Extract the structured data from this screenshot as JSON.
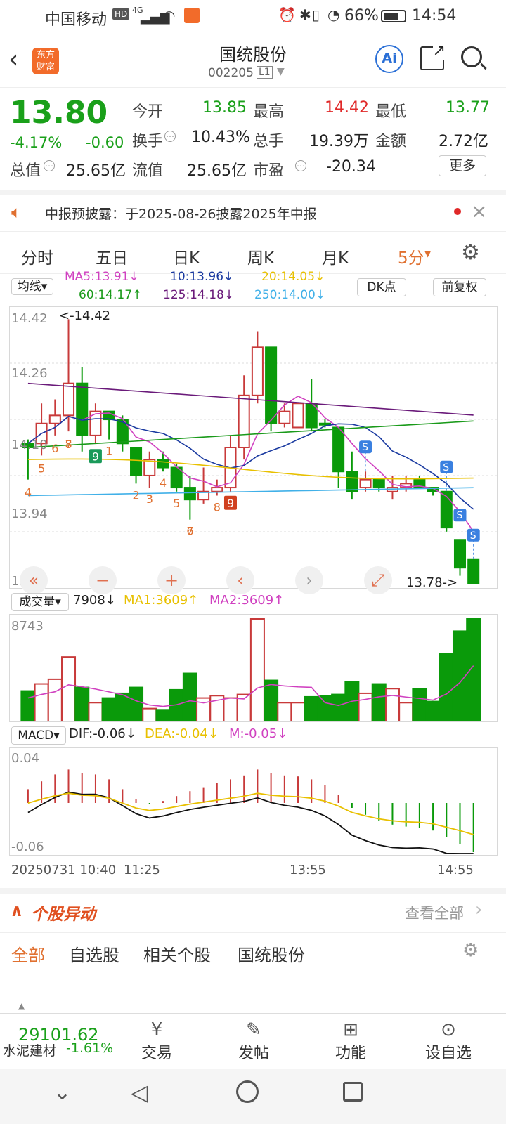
{
  "status": {
    "carrier": "中国移动",
    "hd": "HD",
    "net": "4G",
    "battery": "66%",
    "time": "14:54"
  },
  "header": {
    "title": "国统股份",
    "code": "002205",
    "level": "L1",
    "ai": "Ai"
  },
  "quote": {
    "price": "13.80",
    "pct": "-4.17%",
    "chg": "-0.60",
    "open_label": "今开",
    "open": "13.85",
    "high_label": "最高",
    "high": "14.42",
    "low_label": "最低",
    "low": "13.77",
    "turn_label": "换手",
    "turn": "10.43%",
    "vol_label": "总手",
    "vol": "19.39万",
    "amt_label": "金额",
    "amt": "2.72亿",
    "mcap_label": "总值",
    "mcap": "25.65亿",
    "fcap_label": "流值",
    "fcap": "25.65亿",
    "pe_label": "市盈",
    "pe": "-20.34",
    "more": "更多"
  },
  "notice": {
    "text": "中报预披露：于2025-08-26披露2025年中报"
  },
  "tabs": [
    "分时",
    "五日",
    "日K",
    "周K",
    "月K",
    "5分"
  ],
  "ma_bar": {
    "select": "均线",
    "dk": "DK点",
    "adj": "前复权",
    "ma5": "MA5:13.91↓",
    "ma10": "10:13.96↓",
    "ma20": "20:14.05↓",
    "ma60": "60:14.17↑",
    "ma125": "125:14.18↓",
    "ma250": "250:14.00↓"
  },
  "kline": {
    "ymax": "14.42",
    "y2": "14.26",
    "y3": "14.10",
    "y4": "13.94",
    "ymin": "13.78",
    "hi_note": "<-14.42",
    "lo_note": "13.78->",
    "signals": [
      "S",
      "S",
      "S",
      "S"
    ],
    "counts": [
      {
        "t": "4"
      },
      {
        "t": "5"
      },
      {
        "t": "6"
      },
      {
        "t": "7"
      },
      {
        "t": "8"
      },
      {
        "t": "9"
      },
      {
        "t": "1"
      },
      {
        "t": "2"
      },
      {
        "t": "3"
      },
      {
        "t": "4"
      },
      {
        "t": "5"
      },
      {
        "t": "6"
      },
      {
        "t": "7"
      },
      {
        "t": "8"
      },
      {
        "t": "9"
      }
    ]
  },
  "volume": {
    "select": "成交量",
    "value": "7908↓",
    "ma1": "MA1:3609↑",
    "ma2": "MA2:3609↑",
    "ymax": "8743"
  },
  "macd": {
    "select": "MACD",
    "dif": "DIF:-0.06↓",
    "dea": "DEA:-0.04↓",
    "m": "M:-0.05↓",
    "ymax": "0.04",
    "ymin": "-0.06"
  },
  "xaxis": {
    "start": "20250731 10:40",
    "t1": "11:25",
    "t2": "13:55",
    "t3": "14:55"
  },
  "chart_data": {
    "type": "candlestick",
    "candles": [
      [
        14.1,
        14.12,
        14.02,
        14.11,
        "d"
      ],
      [
        14.11,
        14.21,
        14.08,
        14.16,
        "u"
      ],
      [
        14.16,
        14.22,
        14.13,
        14.18,
        "u"
      ],
      [
        14.18,
        14.42,
        14.14,
        14.26,
        "u"
      ],
      [
        14.26,
        14.3,
        14.09,
        14.13,
        "d"
      ],
      [
        14.13,
        14.21,
        14.11,
        14.19,
        "u"
      ],
      [
        14.19,
        14.19,
        14.12,
        14.17,
        "d"
      ],
      [
        14.17,
        14.18,
        14.09,
        14.11,
        "d"
      ],
      [
        14.1,
        14.1,
        14.01,
        14.03,
        "d"
      ],
      [
        14.03,
        14.09,
        14.0,
        14.07,
        "u"
      ],
      [
        14.07,
        14.09,
        14.04,
        14.05,
        "d"
      ],
      [
        14.05,
        14.06,
        13.99,
        14.0,
        "d"
      ],
      [
        14.0,
        14.03,
        13.92,
        13.97,
        "d"
      ],
      [
        13.97,
        14.05,
        13.96,
        13.99,
        "u"
      ],
      [
        13.99,
        14.02,
        13.98,
        14.0,
        "u"
      ],
      [
        14.0,
        14.13,
        13.99,
        14.1,
        "u"
      ],
      [
        14.1,
        14.28,
        14.07,
        14.23,
        "u"
      ],
      [
        14.23,
        14.39,
        14.21,
        14.35,
        "u"
      ],
      [
        14.35,
        14.35,
        14.14,
        14.16,
        "d"
      ],
      [
        14.16,
        14.21,
        14.15,
        14.19,
        "u"
      ],
      [
        14.15,
        14.21,
        14.15,
        14.21,
        "u"
      ],
      [
        14.21,
        14.27,
        14.14,
        14.15,
        "d"
      ],
      [
        14.16,
        14.17,
        14.15,
        14.16,
        "d"
      ],
      [
        14.15,
        14.15,
        14.0,
        14.04,
        "d"
      ],
      [
        14.04,
        14.09,
        13.97,
        13.99,
        "d"
      ],
      [
        14.0,
        14.04,
        13.99,
        14.02,
        "u"
      ],
      [
        14.02,
        14.02,
        13.99,
        14.0,
        "d"
      ],
      [
        14.0,
        14.03,
        13.97,
        13.99,
        "u"
      ],
      [
        14.0,
        14.03,
        13.99,
        14.01,
        "u"
      ],
      [
        14.02,
        14.03,
        14.0,
        14.0,
        "d"
      ],
      [
        14.0,
        14.0,
        13.98,
        13.99,
        "d"
      ],
      [
        13.99,
        13.99,
        13.89,
        13.9,
        "d"
      ],
      [
        13.87,
        13.87,
        13.78,
        13.8,
        "d"
      ],
      [
        13.82,
        13.82,
        13.76,
        13.76,
        "d"
      ]
    ],
    "volume": [
      2600,
      3200,
      3600,
      5500,
      2900,
      1600,
      2000,
      2400,
      2900,
      1100,
      1000,
      2700,
      4100,
      2000,
      2200,
      2000,
      2300,
      8743,
      3500,
      1600,
      1600,
      2100,
      2200,
      2300,
      3400,
      2400,
      3200,
      2800,
      1600,
      2800,
      1700,
      5800,
      7700,
      8743,
      8100
    ],
    "macd": [
      0.014,
      0.022,
      0.029,
      0.034,
      0.03,
      0.029,
      0.024,
      0.014,
      0.004,
      -0.001,
      0.002,
      0.007,
      0.012,
      0.016,
      0.02,
      0.024,
      0.028,
      0.034,
      0.03,
      0.028,
      0.027,
      0.024,
      0.018,
      0.008,
      -0.005,
      -0.012,
      -0.018,
      -0.022,
      -0.024,
      -0.025,
      -0.028,
      -0.035,
      -0.042,
      -0.05
    ]
  },
  "anomaly": {
    "title": "个股异动",
    "see_all": "查看全部",
    "tabs": [
      "全部",
      "自选股",
      "相关个股",
      "国统股份"
    ]
  },
  "bottom": {
    "index_val": "29101.62",
    "index_name": "水泥建材",
    "index_pct": "-1.61%",
    "items": [
      "交易",
      "发帖",
      "功能",
      "设自选"
    ]
  }
}
